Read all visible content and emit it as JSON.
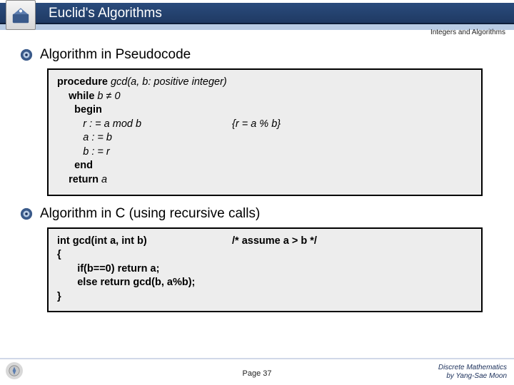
{
  "header": {
    "title": "Euclid's Algorithms",
    "topic": "Integers and Algorithms"
  },
  "sections": {
    "s1_title": "Algorithm in Pseudocode",
    "s2_title": "Algorithm in C (using recursive calls)"
  },
  "pseudo": {
    "l1_kw": "procedure",
    "l1_rest": " gcd(a, b: positive integer)",
    "l2_kw": "while",
    "l2_rest": " b ≠ 0",
    "l3": "begin",
    "l4_left": "         r : = a mod b",
    "l4_right": "{r = a % b}",
    "l5": "         a : = b",
    "l6": "         b : = r",
    "l7": "end",
    "l8_kw": "return",
    "l8_rest": " a"
  },
  "ccode": {
    "l1_left": "int gcd(int a, int b)",
    "l1_right": "/* assume a > b */",
    "l2": "{",
    "l3": "       if(b==0) return a;",
    "l4": "       else return gcd(b, a%b);",
    "l5": "}"
  },
  "footer": {
    "page": "Page 37",
    "credit1": "Discrete Mathematics",
    "credit2": "by Yang-Sae Moon"
  }
}
